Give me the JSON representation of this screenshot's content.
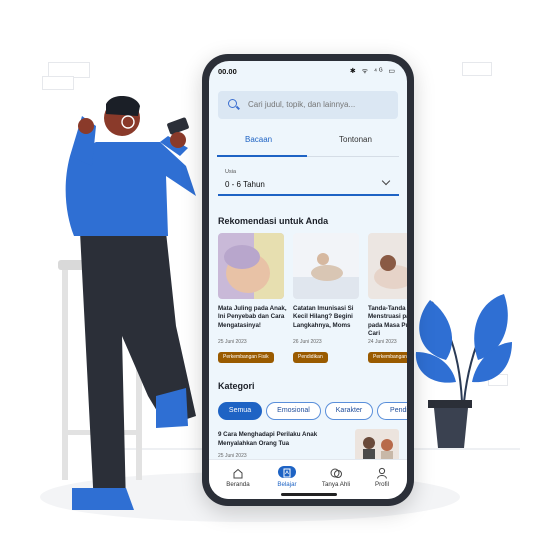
{
  "status": {
    "time": "00.00",
    "icons": "✱ ᯤ ⁴ᴳ ▭"
  },
  "search": {
    "placeholder": "Cari judul, topik, dan lainnya..."
  },
  "tabs": [
    {
      "label": "Bacaan",
      "active": true
    },
    {
      "label": "Tontonan",
      "active": false
    }
  ],
  "age_filter": {
    "label": "Usia",
    "value": "0 - 6 Tahun"
  },
  "recommendations": {
    "title": "Rekomendasi untuk Anda",
    "cards": [
      {
        "title": "Mata Juling pada Anak, Ini Penyebab dan Cara Mengatasinya!",
        "date": "25 Juni 2023",
        "badge": "Perkembangan Fisik"
      },
      {
        "title": "Catatan Imunisasi Si Kecil Hilang? Begini Langkahnya, Moms",
        "date": "26 Juni 2023",
        "badge": "Pendidikan"
      },
      {
        "title": "Tanda-Tanda Menstruasi pada Anak pada Masa Pubertas, Cari",
        "date": "24 Juni 2023",
        "badge": "Perkembangan"
      }
    ]
  },
  "categories": {
    "title": "Kategori",
    "chips": [
      {
        "label": "Semua",
        "active": true
      },
      {
        "label": "Emosional",
        "active": false
      },
      {
        "label": "Karakter",
        "active": false
      },
      {
        "label": "Pendi",
        "active": false
      }
    ]
  },
  "article": {
    "title": "9 Cara Menghadapi Perilaku Anak Menyalahkan Orang Tua",
    "date": "25 Juni 2023"
  },
  "bottom_nav": [
    {
      "label": "Beranda",
      "icon": "home-icon",
      "active": false
    },
    {
      "label": "Belajar",
      "icon": "book-icon",
      "active": true
    },
    {
      "label": "Tanya Ahli",
      "icon": "chat-icon",
      "active": false
    },
    {
      "label": "Profil",
      "icon": "person-icon",
      "active": false
    }
  ],
  "colors": {
    "primary": "#1e63c4",
    "badge": "#9a5b00",
    "screen_bg": "#eef6fc",
    "illustration_blue": "#2f6fd3"
  }
}
